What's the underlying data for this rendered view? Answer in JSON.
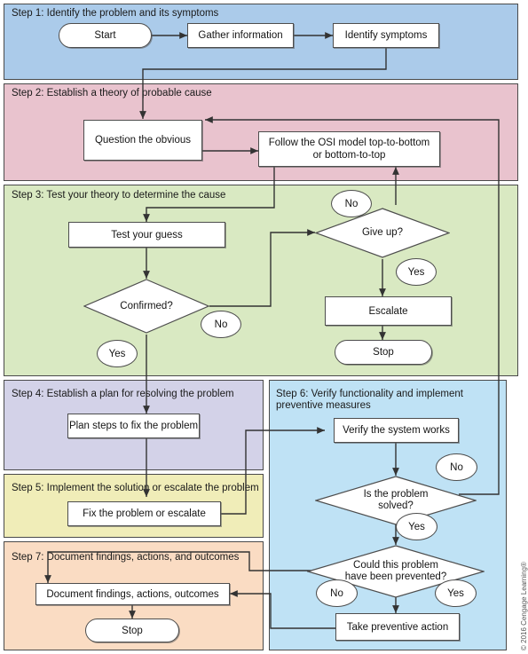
{
  "diagram": {
    "copyright": "© 2016 Cengage Learning®",
    "colors": {
      "step1_bg": "#abcbea",
      "step2_bg": "#e9c3ce",
      "step3_bg": "#d9e9c2",
      "step4_bg": "#d3d2e8",
      "step5_bg": "#f0edb8",
      "step6_bg": "#bfe2f5",
      "step7_bg": "#fadcc3",
      "border": "#4a4a4a",
      "node_fill": "#ffffff",
      "line": "#333333"
    },
    "bands": [
      {
        "id": "step1",
        "title": "Step 1: Identify the problem and its symptoms"
      },
      {
        "id": "step2",
        "title": "Step 2: Establish a theory of probable cause"
      },
      {
        "id": "step3",
        "title": "Step 3: Test your theory to determine the cause"
      },
      {
        "id": "step4",
        "title": "Step 4: Establish a plan for resolving the problem"
      },
      {
        "id": "step5",
        "title": "Step 5: Implement the solution or escalate the problem"
      },
      {
        "id": "step6",
        "title": "Step 6: Verify functionality and implement\npreventive measures"
      },
      {
        "id": "step7",
        "title": "Step 7: Document findings, actions, and outcomes"
      }
    ],
    "nodes": {
      "start": "Start",
      "gather_information": "Gather information",
      "identify_symptoms": "Identify symptoms",
      "question_the_obvious": "Question the obvious",
      "follow_osi_model": "Follow the OSI model top-to-bottom\nor bottom-to-top",
      "test_your_guess": "Test your guess",
      "confirmed": "Confirmed?",
      "give_up": "Give up?",
      "escalate": "Escalate",
      "stop_step3": "Stop",
      "plan_steps": "Plan steps to fix the problem",
      "fix_or_escalate": "Fix the problem or escalate",
      "verify_system_works": "Verify the system works",
      "is_problem_solved": "Is the problem\nsolved?",
      "could_be_prevented": "Could this problem\nhave been prevented?",
      "take_preventive_action": "Take preventive action",
      "document_findings": "Document findings, actions, outcomes",
      "stop_step7": "Stop"
    },
    "branch_labels": {
      "confirmed_yes": "Yes",
      "confirmed_no": "No",
      "giveup_no": "No",
      "giveup_yes": "Yes",
      "solved_no": "No",
      "solved_yes": "Yes",
      "prevented_no": "No",
      "prevented_yes": "Yes"
    }
  }
}
